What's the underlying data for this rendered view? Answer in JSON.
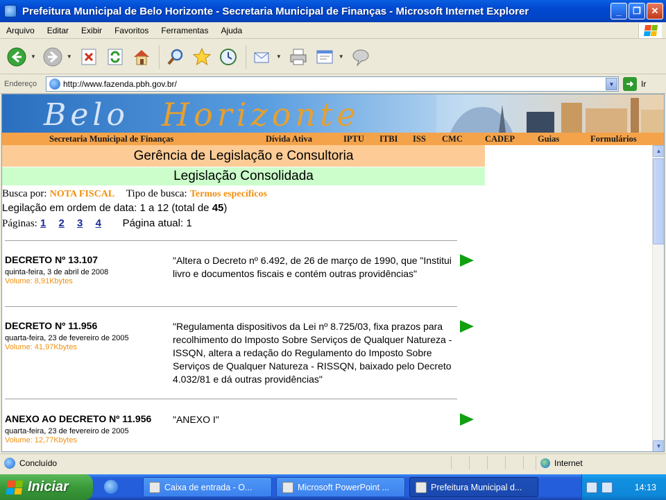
{
  "window": {
    "title": "Prefeitura Municipal de Belo Horizonte - Secretaria Municipal de Finanças - Microsoft Internet Explorer"
  },
  "menu": [
    "Arquivo",
    "Editar",
    "Exibir",
    "Favoritos",
    "Ferramentas",
    "Ajuda"
  ],
  "address": {
    "label": "Endereço",
    "url": "http://www.fazenda.pbh.gov.br/",
    "go": "Ir"
  },
  "banner": {
    "logo_part1": "Belo",
    "logo_part2": "Horizonte"
  },
  "nav": {
    "secretaria": "Secretaria Municipal de Finanças",
    "items": [
      "Dívida Ativa",
      "IPTU",
      "ITBI",
      "ISS",
      "CMC",
      "CADEP",
      "Guias",
      "Formulários"
    ]
  },
  "page": {
    "heading1": "Gerência de Legislação e Consultoria",
    "heading2": "Legislação Consolidada",
    "busca_label": "Busca por:",
    "busca_value": "NOTA FISCAL",
    "tipo_label": "Tipo de busca:",
    "tipo_value": "Termos específicos",
    "ordem_prefix": "Legilação em ordem de data: 1 a 12 (total de ",
    "ordem_total": "45",
    "ordem_suffix": ")",
    "paginas_label": "Páginas:",
    "paginas": [
      "1",
      "2",
      "3",
      "4"
    ],
    "pagina_atual": "Página atual:  1"
  },
  "entries": [
    {
      "title": "DECRETO Nº 13.107",
      "date": "quinta-feira, 3 de abril de 2008",
      "volume": "Volume: 8,91Kbytes",
      "description": "\"Altera o Decreto nº 6.492, de 26 de março de 1990, que \"Institui livro e documentos fiscais e contém outras providências\""
    },
    {
      "title": "DECRETO Nº 11.956",
      "date": "quarta-feira, 23 de fevereiro de 2005",
      "volume": "Volume: 41,97Kbytes",
      "description": "\"Regulamenta dispositivos da Lei nº 8.725/03, fixa prazos para recolhimento do Imposto Sobre Serviços de Qualquer Natureza - ISSQN, altera a redação do Regulamento do Imposto Sobre Serviços de Qualquer Natureza - RISSQN, baixado pelo Decreto 4.032/81 e dá outras providências\""
    },
    {
      "title": "ANEXO AO DECRETO Nº 11.956",
      "date": "quarta-feira, 23 de fevereiro de 2005",
      "volume": "Volume: 12,77Kbytes",
      "description": "\"ANEXO I\""
    }
  ],
  "status": {
    "text": "Concluído",
    "zone": "Internet"
  },
  "taskbar": {
    "start": "Iniciar",
    "tasks": [
      "Caixa de entrada - O...",
      "Microsoft PowerPoint ...",
      "Prefeitura Municipal d..."
    ],
    "clock": "14:13"
  },
  "colors": {
    "nav_orange": "#f5a34a",
    "heading1_bg": "#fdcc96",
    "heading2_bg": "#ccfecc",
    "accent_orange": "#f09010",
    "arrow_green": "#10a010"
  }
}
